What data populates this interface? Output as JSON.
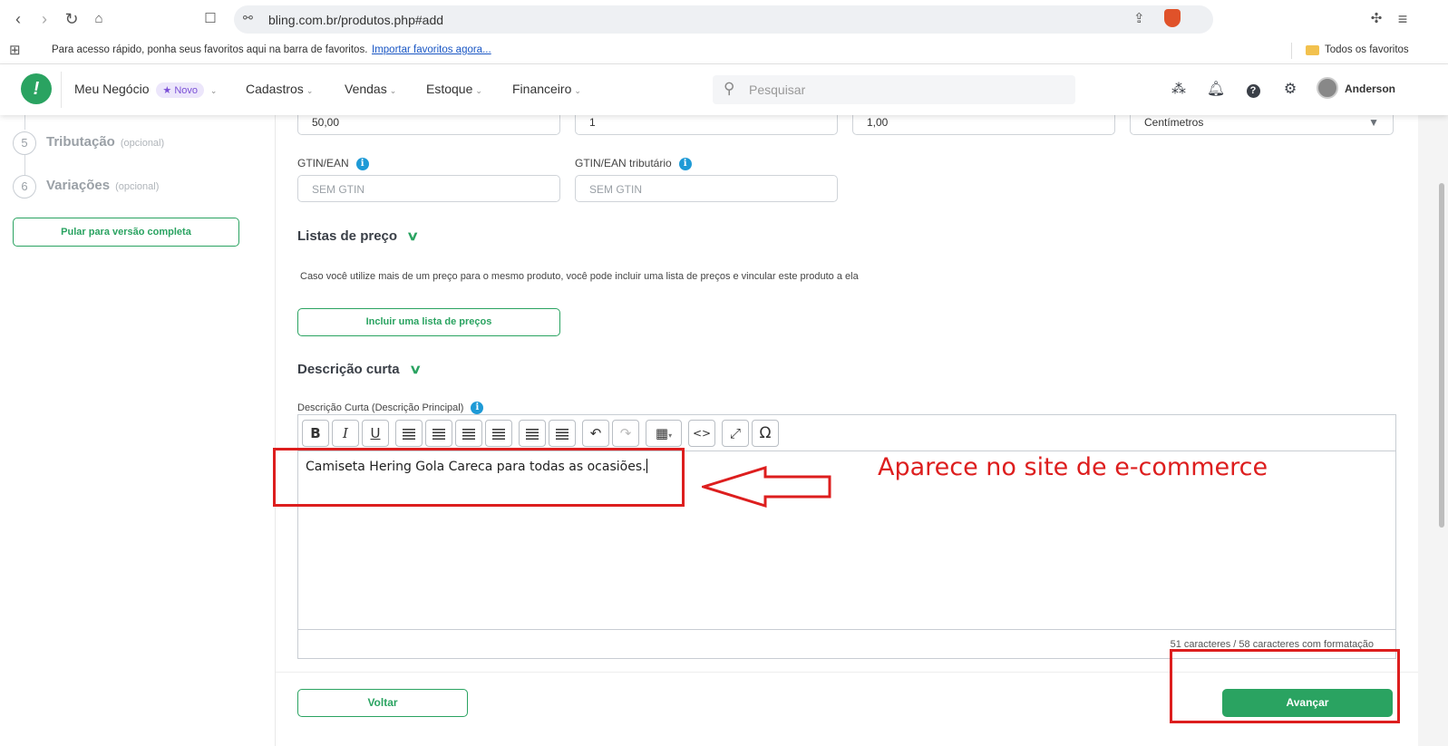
{
  "browser": {
    "url": "bling.com.br/produtos.php#add",
    "bookmarks_hint": "Para acesso rápido, ponha seus favoritos aqui na barra de favoritos.",
    "bookmarks_import": "Importar favoritos agora...",
    "all_favorites": "Todos os favoritos"
  },
  "header": {
    "menu": {
      "meu_negocio": "Meu Negócio",
      "novo_badge": "Novo",
      "cadastros": "Cadastros",
      "vendas": "Vendas",
      "estoque": "Estoque",
      "financeiro": "Financeiro"
    },
    "search_placeholder": "Pesquisar",
    "user_name": "Anderson"
  },
  "sidebar": {
    "steps": [
      {
        "num": "5",
        "label": "Tributação",
        "optional": "(opcional)"
      },
      {
        "num": "6",
        "label": "Variações",
        "optional": "(opcional)"
      }
    ],
    "skip_button": "Pular para versão completa"
  },
  "form": {
    "dims": {
      "field1": "50,00",
      "field2": "1",
      "field3": "1,00",
      "unit": "Centímetros"
    },
    "gtin_label": "GTIN/EAN",
    "gtin_placeholder": "SEM GTIN",
    "gtin_trib_label": "GTIN/EAN tributário",
    "gtin_trib_placeholder": "SEM GTIN",
    "price_lists_title": "Listas de preço",
    "price_lists_desc": "Caso você utilize mais de um preço para o mesmo produto, você pode incluir uma lista de preços e vincular este produto a ela",
    "price_lists_button": "Incluir uma lista de preços",
    "short_desc_title": "Descrição curta",
    "short_desc_label": "Descrição Curta (Descrição Principal)",
    "editor_text": "Camiseta Hering Gola Careca para todas as ocasiões.",
    "char_count": "51 caracteres / 58 caracteres com formatação"
  },
  "toolbar": {
    "bold": "B",
    "italic": "I",
    "underline": "U",
    "omega": "Ω",
    "code": "<>"
  },
  "footer": {
    "back_button": "Voltar",
    "next_button": "Avançar"
  },
  "annotation": {
    "text": "Aparece no site de e-commerce",
    "color": "#dd1e1e"
  },
  "colors": {
    "brand_green": "#2aa361",
    "info_blue": "#1e9ad6"
  }
}
